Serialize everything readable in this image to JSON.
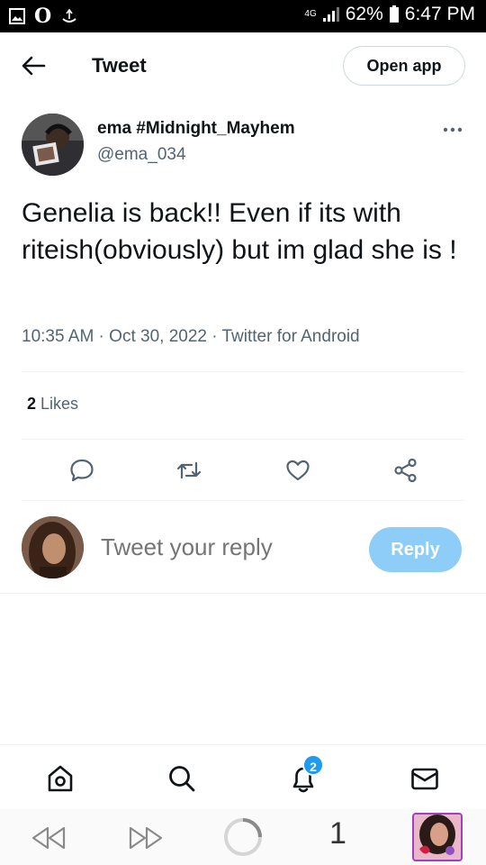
{
  "status_bar": {
    "network": "4G",
    "battery": "62%",
    "time": "6:47 PM"
  },
  "header": {
    "title": "Tweet",
    "open_app_label": "Open app"
  },
  "author": {
    "display_name": "ema #Midnight_Mayhem",
    "handle": "@ema_034"
  },
  "tweet": {
    "text": "Genelia is back!! Even if its with riteish(obviously) but im glad she is !",
    "meta": "10:35 AM · Oct 30, 2022 · Twitter for Android"
  },
  "stats": {
    "likes_count": "2",
    "likes_label": "Likes"
  },
  "actions": [
    "reply-icon",
    "retweet-icon",
    "like-icon",
    "share-icon"
  ],
  "reply": {
    "placeholder": "Tweet your reply",
    "button_label": "Reply"
  },
  "bottom_nav": {
    "items": [
      "home-icon",
      "search-icon",
      "notifications-icon",
      "messages-icon"
    ],
    "notifications_badge": "2"
  },
  "browser_bar": {
    "tab_count": "1"
  },
  "colors": {
    "accent": "#1d9bf0",
    "reply_button_disabled": "#8ecdf8",
    "secondary_text": "#536471",
    "divider": "#eff3f4"
  }
}
